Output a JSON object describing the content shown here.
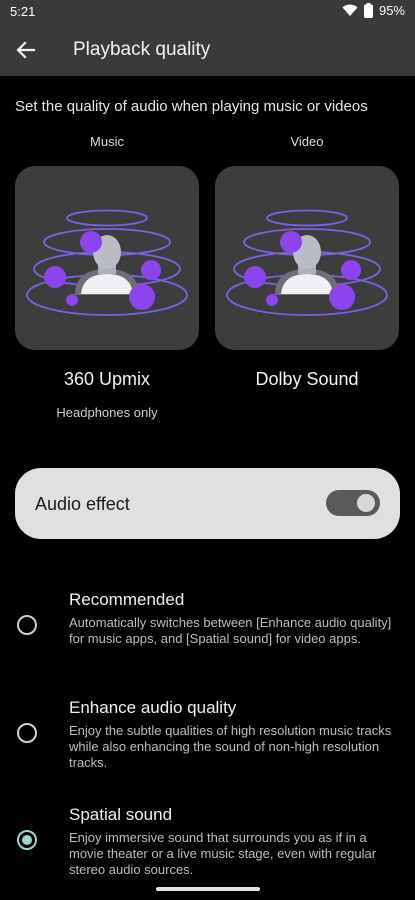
{
  "status_bar": {
    "time": "5:21",
    "battery": "95%",
    "icons": [
      "wifi-icon",
      "battery-icon"
    ]
  },
  "app_bar": {
    "title": "Playback quality",
    "back_icon": "arrow-back-icon"
  },
  "subtitle": "Set the quality of audio when playing music or videos",
  "music": {
    "label": "Music",
    "title": "360 Upmix",
    "subtitle": "Headphones only"
  },
  "video": {
    "label": "Video",
    "title": "Dolby Sound"
  },
  "audio_effect": {
    "label": "Audio effect",
    "enabled": true
  },
  "options": [
    {
      "title": "Recommended",
      "description": "Automatically switches between [Enhance audio quality] for music apps, and [Spatial sound] for video apps.",
      "selected": false
    },
    {
      "title": "Enhance audio quality",
      "description": "Enjoy the subtle qualities of high resolution music tracks while also enhancing the sound of non-high resolution tracks.",
      "selected": false
    },
    {
      "title": "Spatial sound",
      "description": "Enjoy immersive sound that surrounds you as if in a movie theater or a live music stage, even with regular stereo audio sources.",
      "selected": true
    }
  ],
  "colors": {
    "accent": "#9bd7d0",
    "orb": "#8c45ee",
    "ring": "#7a62e0",
    "card": "#3d3d3d"
  }
}
